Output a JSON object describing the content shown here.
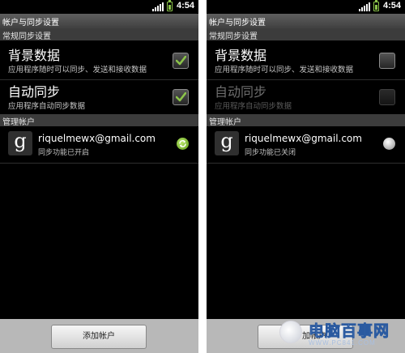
{
  "status_bar": {
    "time": "4:54"
  },
  "title": "帐户与同步设置",
  "sections": {
    "general": "常规同步设置",
    "accounts": "管理帐户"
  },
  "left": {
    "background_data": {
      "title": "背景数据",
      "summary": "应用程序随时可以同步、发送和接收数据",
      "checked": true
    },
    "auto_sync": {
      "title": "自动同步",
      "summary": "应用程序自动同步数据",
      "checked": true,
      "enabled": true
    },
    "account": {
      "email": "riquelmewx@gmail.com",
      "status": "同步功能已开启",
      "icon": "google-g-icon"
    }
  },
  "right": {
    "background_data": {
      "title": "背景数据",
      "summary": "应用程序随时可以同步、发送和接收数据",
      "checked": false
    },
    "auto_sync": {
      "title": "自动同步",
      "summary": "应用程序自动同步数据",
      "checked": false,
      "enabled": false
    },
    "account": {
      "email": "riquelmewx@gmail.com",
      "status": "同步功能已关闭",
      "icon": "google-g-icon"
    }
  },
  "buttons": {
    "add_account": "添加帐户",
    "add_account_partial": "加帐户"
  },
  "watermark": {
    "text": "电脑百事网",
    "subtext": "WWW.PC841.COM"
  },
  "icons": {
    "google": "g",
    "sync_enabled": "sync-icon",
    "sync_disabled": "sync-off-icon"
  },
  "colors": {
    "checkmark": "#8bc34a",
    "sync_on": "#7cc13a",
    "battery": "#8bc34a"
  }
}
